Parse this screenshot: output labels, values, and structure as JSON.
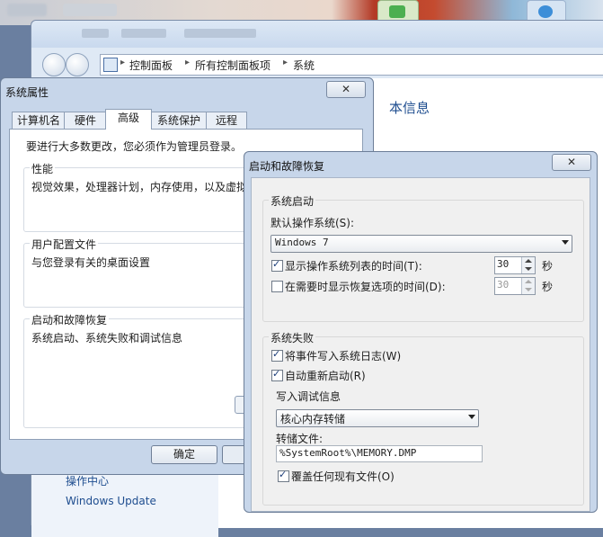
{
  "explorer": {
    "address": [
      "控制面板",
      "所有控制面板项",
      "系统"
    ],
    "heading": "本信息",
    "sidebar_links": [
      "操作中心",
      "Windows Update"
    ]
  },
  "system_properties": {
    "title": "系统属性",
    "close_glyph": "✕",
    "tabs": [
      "计算机名",
      "硬件",
      "高级",
      "系统保护",
      "远程"
    ],
    "active_tab": "高级",
    "admin_note": "要进行大多数更改，您必须作为管理员登录。",
    "groups": [
      {
        "title": "性能",
        "desc": "视觉效果，处理器计划，内存使用，以及虚拟"
      },
      {
        "title": "用户配置文件",
        "desc": "与您登录有关的桌面设置"
      },
      {
        "title": "启动和故障恢复",
        "desc": "系统启动、系统失败和调试信息"
      }
    ],
    "ok_label": "确定"
  },
  "startup_recovery": {
    "title": "启动和故障恢复",
    "close_glyph": "✕",
    "system_startup": {
      "legend": "系统启动",
      "default_os_label": "默认操作系统(S):",
      "default_os_value": "Windows 7",
      "show_list": {
        "label": "显示操作系统列表的时间(T):",
        "checked": true,
        "value": "30",
        "unit": "秒"
      },
      "show_recovery": {
        "label": "在需要时显示恢复选项的时间(D):",
        "checked": false,
        "value": "30",
        "unit": "秒"
      }
    },
    "system_failure": {
      "legend": "系统失败",
      "write_event": {
        "label": "将事件写入系统日志(W)",
        "checked": true
      },
      "auto_restart": {
        "label": "自动重新启动(R)",
        "checked": true
      },
      "debug_legend": "写入调试信息",
      "debug_type": "核心内存转储",
      "dump_file_label": "转储文件:",
      "dump_file_value": "%SystemRoot%\\MEMORY.DMP",
      "overwrite": {
        "label": "覆盖任何现有文件(O)",
        "checked": true
      }
    }
  }
}
